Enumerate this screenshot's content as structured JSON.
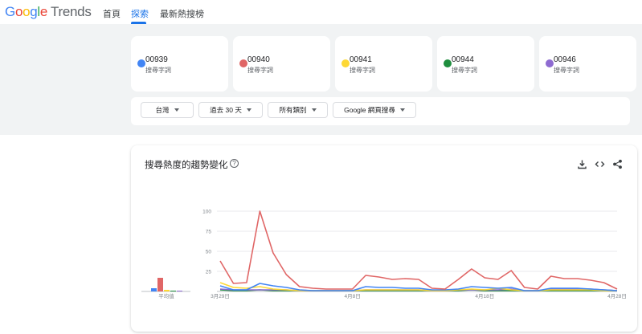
{
  "header": {
    "logo_google": "Google",
    "logo_trends": "Trends",
    "nav": [
      "首頁",
      "探索",
      "最新熱搜榜"
    ],
    "active_index": 1
  },
  "terms": [
    {
      "name": "00939",
      "sub": "搜尋字詞",
      "color": "#4285f4"
    },
    {
      "name": "00940",
      "sub": "搜尋字詞",
      "color": "#e06666"
    },
    {
      "name": "00941",
      "sub": "搜尋字詞",
      "color": "#fdd835"
    },
    {
      "name": "00944",
      "sub": "搜尋字詞",
      "color": "#1e8e3e"
    },
    {
      "name": "00946",
      "sub": "搜尋字詞",
      "color": "#8e6bd1"
    }
  ],
  "filters": [
    "台灣",
    "過去 30 天",
    "所有類別",
    "Google 網頁搜尋"
  ],
  "chart_section": {
    "title": "搜尋熱度的趨勢變化",
    "help_icon": "help-icon",
    "tools": [
      "download-icon",
      "embed-code-icon",
      "share-icon"
    ]
  },
  "chart_data": {
    "type": "line",
    "x": [
      "3月29日",
      "3月30日",
      "3月31日",
      "4月1日",
      "4月2日",
      "4月3日",
      "4月4日",
      "4月5日",
      "4月6日",
      "4月7日",
      "4月8日",
      "4月9日",
      "4月10日",
      "4月11日",
      "4月12日",
      "4月13日",
      "4月14日",
      "4月15日",
      "4月16日",
      "4月17日",
      "4月18日",
      "4月19日",
      "4月20日",
      "4月21日",
      "4月22日",
      "4月23日",
      "4月24日",
      "4月25日",
      "4月26日",
      "4月27日",
      "4月28日"
    ],
    "x_tick_labels": [
      "3月29日",
      "4月8日",
      "4月18日",
      "4月28日"
    ],
    "y_tick_labels": [
      "100",
      "75",
      "50",
      "25"
    ],
    "ylim": [
      0,
      100
    ],
    "grid": true,
    "average_label": "平均值",
    "averages": [
      {
        "name": "00939",
        "value": 4
      },
      {
        "name": "00940",
        "value": 17
      },
      {
        "name": "00941",
        "value": 2
      },
      {
        "name": "00944",
        "value": 1
      },
      {
        "name": "00946",
        "value": 1
      }
    ],
    "series": [
      {
        "name": "00939",
        "color": "#4285f4",
        "values": [
          7,
          2,
          2,
          10,
          7,
          5,
          2,
          1,
          1,
          1,
          1,
          6,
          5,
          5,
          4,
          4,
          2,
          2,
          3,
          6,
          5,
          4,
          5,
          1,
          1,
          4,
          4,
          4,
          3,
          2,
          1
        ]
      },
      {
        "name": "00940",
        "color": "#e06666",
        "values": [
          38,
          10,
          11,
          100,
          48,
          21,
          6,
          4,
          3,
          3,
          3,
          20,
          18,
          15,
          16,
          15,
          4,
          3,
          15,
          28,
          17,
          15,
          26,
          5,
          3,
          19,
          16,
          16,
          14,
          11,
          3
        ]
      },
      {
        "name": "00941",
        "color": "#fdd835",
        "values": [
          11,
          5,
          4,
          6,
          3,
          2,
          1,
          1,
          1,
          1,
          1,
          2,
          2,
          2,
          2,
          2,
          1,
          1,
          2,
          3,
          2,
          4,
          2,
          1,
          1,
          2,
          2,
          2,
          2,
          1,
          1
        ]
      },
      {
        "name": "00944",
        "color": "#1e8e3e",
        "values": [
          2,
          1,
          1,
          2,
          1,
          1,
          1,
          1,
          1,
          1,
          1,
          1,
          1,
          1,
          1,
          1,
          1,
          1,
          1,
          2,
          1,
          1,
          1,
          1,
          1,
          1,
          1,
          1,
          1,
          1,
          1
        ]
      },
      {
        "name": "00946",
        "color": "#8e6bd1",
        "values": [
          3,
          2,
          2,
          2,
          2,
          2,
          1,
          1,
          1,
          1,
          1,
          2,
          2,
          2,
          2,
          2,
          1,
          1,
          2,
          2,
          2,
          2,
          3,
          1,
          1,
          3,
          3,
          3,
          3,
          2,
          1
        ]
      }
    ]
  }
}
